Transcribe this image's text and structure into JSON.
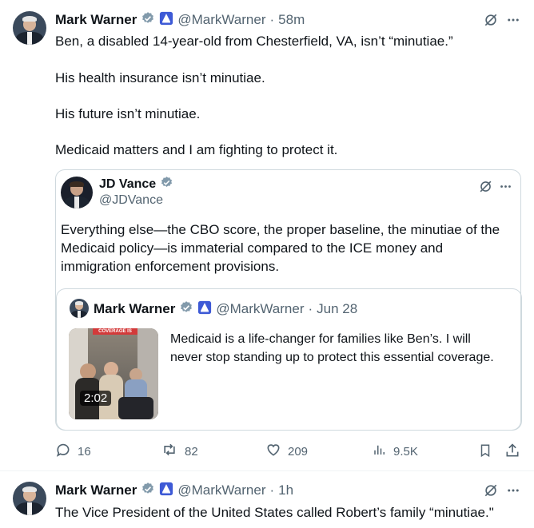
{
  "tweet1": {
    "name": "Mark Warner",
    "handle": "@MarkWarner",
    "dot": "·",
    "time": "58m",
    "lines": [
      "Ben, a disabled 14-year-old from Chesterfield, VA, isn’t “minutiae.”",
      "His health insurance isn’t minutiae.",
      "His future isn’t minutiae.",
      "Medicaid matters and I am fighting to protect it."
    ],
    "quote": {
      "name": "JD Vance",
      "handle": "@JDVance",
      "text": "Everything else—the CBO score, the proper baseline, the minutiae of the Medicaid policy—is immaterial compared to the ICE money and immigration enforcement provisions.",
      "nested": {
        "name": "Mark Warner",
        "handle": "@MarkWarner",
        "dot": "·",
        "date": "Jun 28",
        "text": "Medicaid is a life-changer for families like Ben’s. I will never stop standing up to protect this essential coverage.",
        "video_duration": "2:02",
        "video_banner": "COVERAGE IS"
      }
    },
    "actions": {
      "replies": "16",
      "reposts": "82",
      "likes": "209",
      "views": "9.5K"
    }
  },
  "tweet2": {
    "name": "Mark Warner",
    "handle": "@MarkWarner",
    "dot": "·",
    "time": "1h",
    "text": "The Vice President of the United States called Robert’s family “minutiae.\""
  },
  "colors": {
    "verified": "#829aab",
    "senate_badge": "#3e5ad6",
    "secondary": "#536471",
    "border": "#cfd9de"
  },
  "icons": [
    "verified-badge-icon",
    "senate-badge-icon",
    "grok-icon",
    "more-icon",
    "reply-icon",
    "repost-icon",
    "like-icon",
    "views-icon",
    "bookmark-icon",
    "share-icon"
  ]
}
